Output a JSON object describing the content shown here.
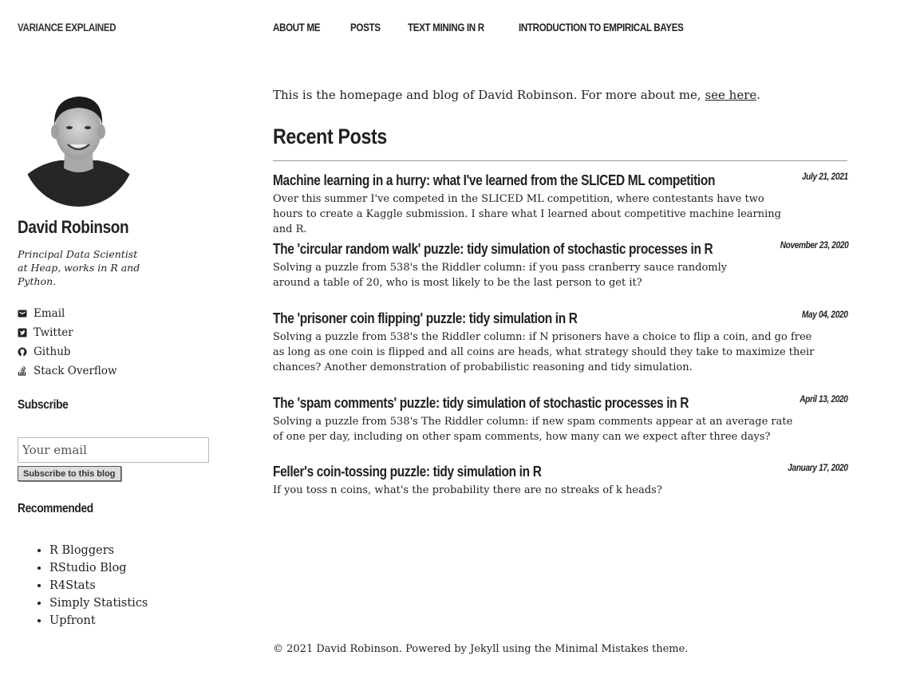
{
  "site": {
    "title": "VARIANCE EXPLAINED"
  },
  "nav": [
    {
      "label": "ABOUT ME"
    },
    {
      "label": "POSTS"
    },
    {
      "label": "TEXT MINING IN R"
    },
    {
      "label": "INTRODUCTION TO EMPIRICAL BAYES"
    }
  ],
  "author": {
    "name": "David Robinson",
    "bio": "Principal Data Scientist at Heap, works in R and Python.",
    "links": [
      {
        "label": "Email",
        "icon": "envelope-icon"
      },
      {
        "label": "Twitter",
        "icon": "twitter-icon"
      },
      {
        "label": "Github",
        "icon": "github-icon"
      },
      {
        "label": "Stack Overflow",
        "icon": "stack-overflow-icon"
      }
    ]
  },
  "subscribe": {
    "heading": "Subscribe",
    "placeholder": "Your email",
    "button": "Subscribe to this blog"
  },
  "recommended": {
    "heading": "Recommended",
    "items": [
      "R Bloggers",
      "RStudio Blog",
      "R4Stats",
      "Simply Statistics",
      "Upfront"
    ]
  },
  "intro": {
    "text": "This is the homepage and blog of David Robinson. For more about me, ",
    "link": "see here",
    "end": "."
  },
  "recent": {
    "heading": "Recent Posts",
    "posts": [
      {
        "title": "Machine learning in a hurry: what I've learned from the SLICED ML competition",
        "date": "July 21, 2021",
        "excerpt": "Over this summer I've competed in the SLICED ML competition, where contestants have two hours to create a Kaggle submission. I share what I learned about competitive machine learning and R."
      },
      {
        "title": "The 'circular random walk' puzzle: tidy simulation of stochastic processes in R",
        "date": "November 23, 2020",
        "excerpt": "Solving a puzzle from 538's the Riddler column: if you pass cranberry sauce randomly around a table of 20, who is most likely to be the last person to get it?"
      },
      {
        "title": "The 'prisoner coin flipping' puzzle: tidy simulation in R",
        "date": "May 04, 2020",
        "excerpt": "Solving a puzzle from 538's the Riddler column: if N prisoners have a choice to flip a coin, and go free as long as one coin is flipped and all coins are heads, what strategy should they take to maximize their chances? Another demonstration of probabilistic reasoning and tidy simulation."
      },
      {
        "title": "The 'spam comments' puzzle: tidy simulation of stochastic processes in R",
        "date": "April 13, 2020",
        "excerpt": "Solving a puzzle from 538's The Riddler column: if new spam comments appear at an average rate of one per day, including on other spam comments, how many can we expect after three days?"
      },
      {
        "title": "Feller's coin-tossing puzzle: tidy simulation in R",
        "date": "January 17, 2020",
        "excerpt": "If you toss n coins, what's the probability there are no streaks of k heads?"
      }
    ]
  },
  "footer": {
    "text": "© 2021 David Robinson. Powered by Jekyll using the Minimal Mistakes theme."
  }
}
